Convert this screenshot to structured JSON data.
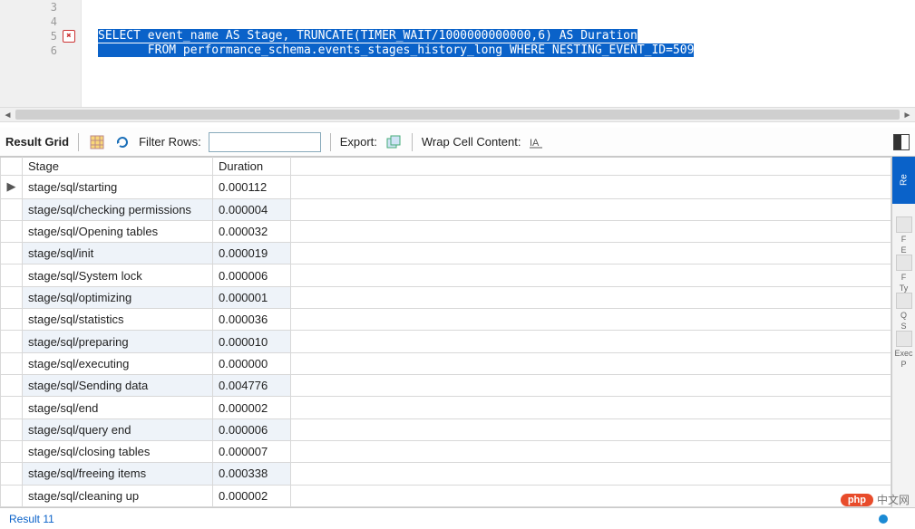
{
  "editor": {
    "lines": [
      {
        "num": "3",
        "mark": null,
        "code": ""
      },
      {
        "num": "4",
        "mark": null,
        "code": ""
      },
      {
        "num": "5",
        "mark": "err",
        "code_sel": "SELECT event_name AS Stage, TRUNCATE(TIMER_WAIT/1000000000000,6) AS Duration"
      },
      {
        "num": "6",
        "mark": null,
        "code_sel": "       FROM performance_schema.events_stages_history_long WHERE NESTING_EVENT_ID=509"
      }
    ]
  },
  "toolbar": {
    "result_grid_label": "Result Grid",
    "filter_label": "Filter Rows:",
    "filter_value": "",
    "export_label": "Export:",
    "wrap_label": "Wrap Cell Content:"
  },
  "grid": {
    "columns": [
      "Stage",
      "Duration"
    ],
    "current_row_indicator": "▶",
    "rows": [
      {
        "stage": "stage/sql/starting",
        "duration": "0.000112"
      },
      {
        "stage": "stage/sql/checking permissions",
        "duration": "0.000004"
      },
      {
        "stage": "stage/sql/Opening tables",
        "duration": "0.000032"
      },
      {
        "stage": "stage/sql/init",
        "duration": "0.000019"
      },
      {
        "stage": "stage/sql/System lock",
        "duration": "0.000006"
      },
      {
        "stage": "stage/sql/optimizing",
        "duration": "0.000001"
      },
      {
        "stage": "stage/sql/statistics",
        "duration": "0.000036"
      },
      {
        "stage": "stage/sql/preparing",
        "duration": "0.000010"
      },
      {
        "stage": "stage/sql/executing",
        "duration": "0.000000"
      },
      {
        "stage": "stage/sql/Sending data",
        "duration": "0.004776"
      },
      {
        "stage": "stage/sql/end",
        "duration": "0.000002"
      },
      {
        "stage": "stage/sql/query end",
        "duration": "0.000006"
      },
      {
        "stage": "stage/sql/closing tables",
        "duration": "0.000007"
      },
      {
        "stage": "stage/sql/freeing items",
        "duration": "0.000338"
      },
      {
        "stage": "stage/sql/cleaning up",
        "duration": "0.000002"
      }
    ]
  },
  "side": {
    "active_tab": "Re",
    "items": [
      {
        "label1": "F",
        "label2": "E"
      },
      {
        "label1": "F",
        "label2": "Ty"
      },
      {
        "label1": "Q",
        "label2": "S"
      },
      {
        "label1": "Exec",
        "label2": "P"
      }
    ]
  },
  "bottom": {
    "tab_label": "Result 11"
  },
  "watermark": {
    "pill": "php",
    "text": "中文网"
  }
}
